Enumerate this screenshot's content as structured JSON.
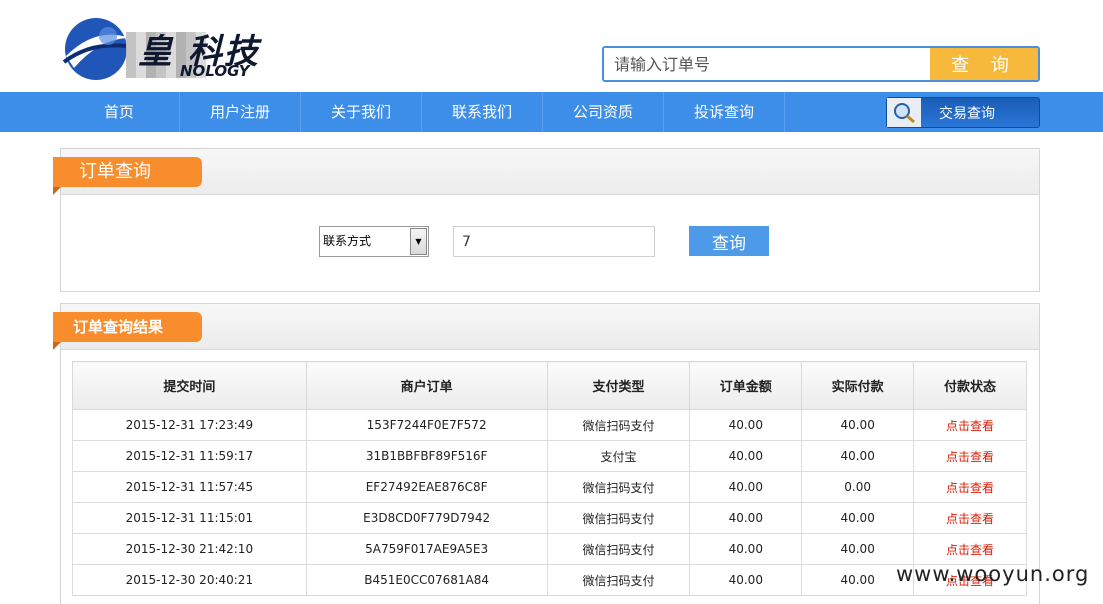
{
  "header": {
    "logo_text": "皇 科技",
    "logo_sub": "NOLOGY",
    "search_placeholder": "请输入订单号",
    "search_button": "查 询"
  },
  "nav": {
    "items": [
      "首页",
      "用户注册",
      "关于我们",
      "联系我们",
      "公司资质",
      "投诉查询"
    ],
    "trade_button": "交易查询"
  },
  "query_panel": {
    "title": "订单查询",
    "select_value": "联系方式",
    "input_value": "7",
    "button": "查询"
  },
  "result_panel": {
    "title": "订单查询结果",
    "columns": [
      "提交时间",
      "商户订单",
      "支付类型",
      "订单金额",
      "实际付款",
      "付款状态"
    ],
    "rows": [
      [
        "2015-12-31 17:23:49",
        "153F7244F0E7F572",
        "微信扫码支付",
        "40.00",
        "40.00",
        "点击查看"
      ],
      [
        "2015-12-31 11:59:17",
        "31B1BBFBF89F516F",
        "支付宝",
        "40.00",
        "40.00",
        "点击查看"
      ],
      [
        "2015-12-31 11:57:45",
        "EF27492EAE876C8F",
        "微信扫码支付",
        "40.00",
        "0.00",
        "点击查看"
      ],
      [
        "2015-12-31 11:15:01",
        "E3D8CD0F779D7942",
        "微信扫码支付",
        "40.00",
        "40.00",
        "点击查看"
      ],
      [
        "2015-12-30 21:42:10",
        "5A759F017AE9A5E3",
        "微信扫码支付",
        "40.00",
        "40.00",
        "点击查看"
      ],
      [
        "2015-12-30 20:40:21",
        "B451E0CC07681A84",
        "微信扫码支付",
        "40.00",
        "40.00",
        "点击查看"
      ]
    ]
  },
  "watermark": "www.wooyun.org",
  "colors": {
    "nav": "#3d8ee8",
    "accent_orange": "#f88d2e",
    "search_button": "#f6b93b",
    "status_link": "#d81e06"
  }
}
